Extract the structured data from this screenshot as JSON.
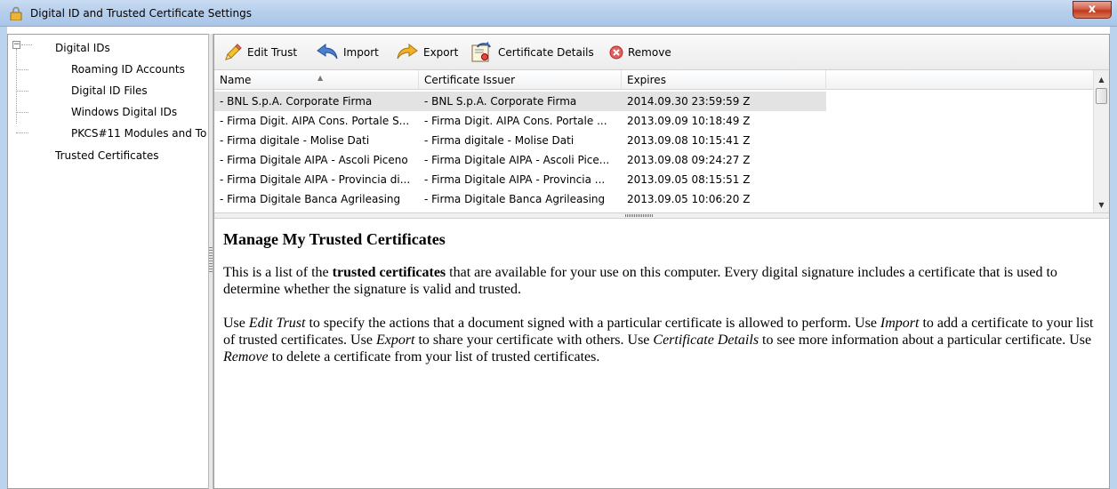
{
  "window": {
    "title": "Digital ID and Trusted Certificate Settings",
    "close_label": "x"
  },
  "tree": {
    "root": "Digital IDs",
    "children": [
      "Roaming ID Accounts",
      "Digital ID Files",
      "Windows Digital IDs",
      "PKCS#11 Modules and To"
    ],
    "sibling": "Trusted Certificates"
  },
  "toolbar": {
    "edit_trust": "Edit Trust",
    "import": "Import",
    "export": "Export",
    "certificate_details": "Certificate Details",
    "remove": "Remove"
  },
  "list": {
    "columns": [
      "Name",
      "Certificate Issuer",
      "Expires"
    ],
    "rows": [
      {
        "name": "- BNL S.p.A. Corporate Firma",
        "issuer": "- BNL S.p.A. Corporate Firma",
        "expires": "2014.09.30 23:59:59 Z",
        "selected": true
      },
      {
        "name": "- Firma Digit. AIPA Cons. Portale S...",
        "issuer": "- Firma Digit. AIPA Cons. Portale ...",
        "expires": "2013.09.09 10:18:49 Z",
        "selected": false
      },
      {
        "name": "- Firma digitale - Molise Dati",
        "issuer": "- Firma digitale - Molise Dati",
        "expires": "2013.09.08 10:15:41 Z",
        "selected": false
      },
      {
        "name": "- Firma Digitale AIPA - Ascoli Piceno",
        "issuer": "- Firma Digitale AIPA - Ascoli Pice...",
        "expires": "2013.09.08 09:24:27 Z",
        "selected": false
      },
      {
        "name": "- Firma Digitale AIPA - Provincia di...",
        "issuer": "- Firma Digitale AIPA - Provincia ...",
        "expires": "2013.09.05 08:15:51 Z",
        "selected": false
      },
      {
        "name": "- Firma Digitale Banca Agrileasing",
        "issuer": "- Firma Digitale Banca Agrileasing",
        "expires": "2013.09.05 10:06:20 Z",
        "selected": false
      }
    ]
  },
  "description": {
    "heading": "Manage My Trusted Certificates",
    "p1_a": "This is a list of the ",
    "p1_b": "trusted certificates",
    "p1_c": " that are available for your use on this computer. Every digital signature includes a certificate that is used to determine whether the signature is valid and trusted.",
    "p2_a": "Use ",
    "p2_b": "Edit Trust",
    "p2_c": " to specify the actions that a document signed with a particular certificate is allowed to perform. Use ",
    "p2_d": "Import",
    "p2_e": " to add a certificate to your list of trusted certificates. Use ",
    "p2_f": "Export",
    "p2_g": " to share your certificate with others. Use ",
    "p2_h": "Certificate Details",
    "p2_i": " to see more information about a particular certificate. Use ",
    "p2_j": "Remove",
    "p2_k": " to delete a certificate from your list of trusted certificates."
  },
  "icons": {
    "lock": "lock-icon",
    "edit_trust": "pencil-icon",
    "import": "import-arrow-icon",
    "export": "export-arrow-icon",
    "certificate_details": "certificate-icon",
    "remove": "remove-x-icon"
  },
  "colors": {
    "selection": "#e3e3e3",
    "titlebar": "#b7cfec",
    "close_button": "#c2381e"
  }
}
